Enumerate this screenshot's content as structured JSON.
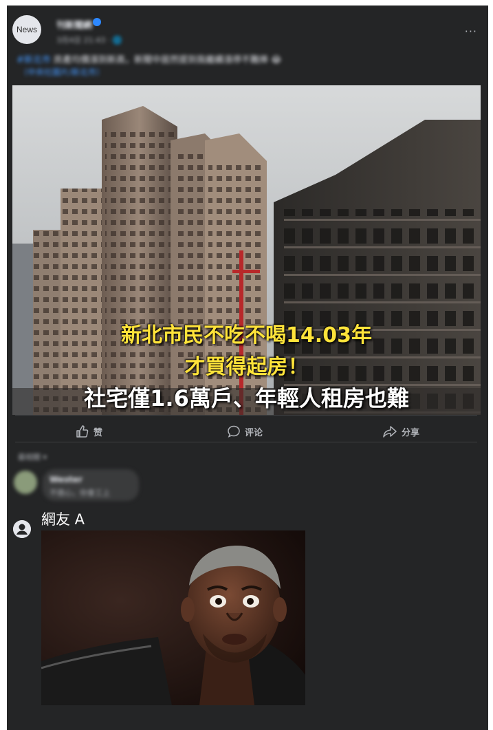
{
  "post": {
    "avatar_label": "News",
    "page_name": "刊新聞網",
    "time": "3月4日 21:43 · 🌐",
    "more_label": "···",
    "caption_tag": "#新北市",
    "caption_text": " 房產均價漲到新高，新聞中居然提到我繼續漲停不難捧 😂",
    "caption_link": "（中央社圖片/新北市）"
  },
  "image_overlay": {
    "line1": "新北市民不吃不喝14.03年",
    "line2": "才買得起房！",
    "line3": "社宅僅1.6萬戶、年輕人租房也難"
  },
  "actions": {
    "like": "赞",
    "comment": "评论",
    "share": "分享"
  },
  "comments": {
    "sort_label": "最相關 ▾",
    "first_commenter": "Wester",
    "first_comment": "不擔心，你會工上",
    "reply_author": "網友 A"
  },
  "colors": {
    "card_bg": "#242526",
    "overlay_yellow": "#ffe33a",
    "link_blue": "#4599ff"
  }
}
